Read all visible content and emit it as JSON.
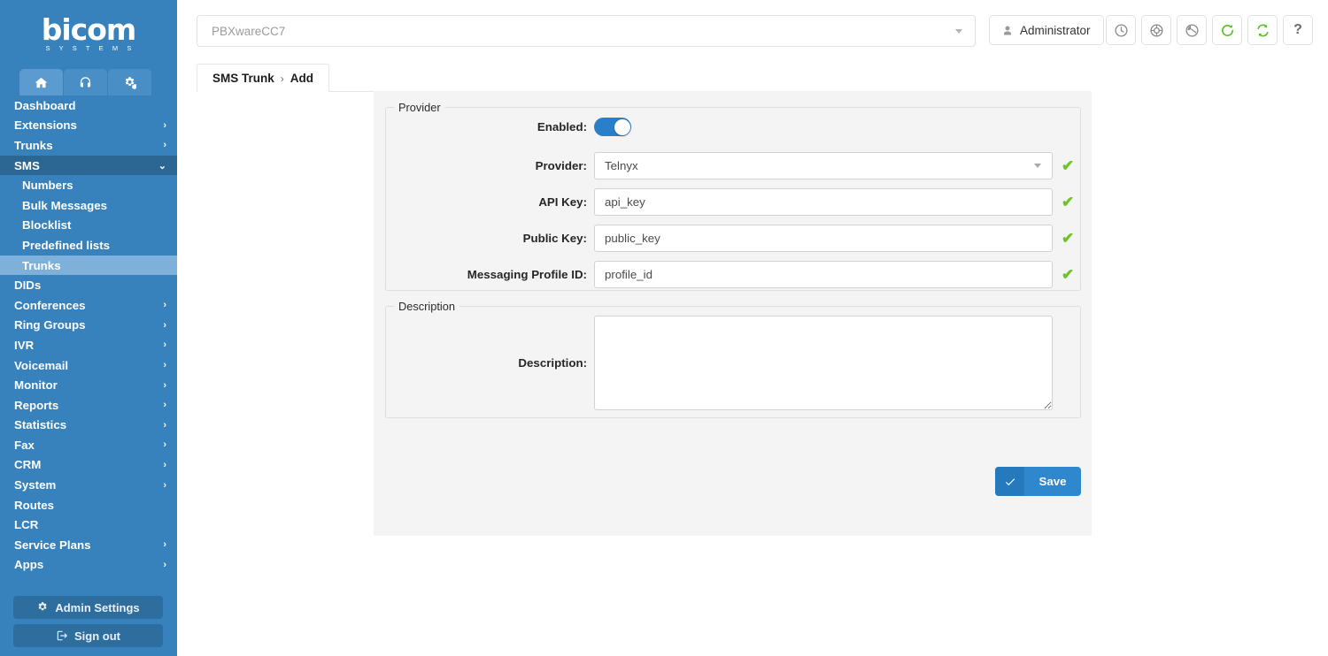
{
  "brand": {
    "word": "bicom",
    "sub": "S Y S T E M S"
  },
  "nav_tabs": [
    {
      "name": "home-tab",
      "icon": "home-icon",
      "active": true
    },
    {
      "name": "headset-tab",
      "icon": "headset-icon",
      "active": false
    },
    {
      "name": "gears-tab",
      "icon": "gears-icon",
      "active": false
    }
  ],
  "sidebar": {
    "items": [
      {
        "label": "Dashboard",
        "arrow": "",
        "state": ""
      },
      {
        "label": "Extensions",
        "arrow": "›",
        "state": ""
      },
      {
        "label": "Trunks",
        "arrow": "›",
        "state": ""
      },
      {
        "label": "SMS",
        "arrow": "⌄",
        "state": "open"
      }
    ],
    "submenu": [
      {
        "label": "Numbers",
        "state": ""
      },
      {
        "label": "Bulk Messages",
        "state": ""
      },
      {
        "label": "Blocklist",
        "state": ""
      },
      {
        "label": "Predefined lists",
        "state": ""
      },
      {
        "label": "Trunks",
        "state": "active"
      }
    ],
    "items_after": [
      {
        "label": "DIDs",
        "arrow": "",
        "state": ""
      },
      {
        "label": "Conferences",
        "arrow": "›",
        "state": ""
      },
      {
        "label": "Ring Groups",
        "arrow": "›",
        "state": ""
      },
      {
        "label": "IVR",
        "arrow": "›",
        "state": ""
      },
      {
        "label": "Voicemail",
        "arrow": "›",
        "state": ""
      },
      {
        "label": "Monitor",
        "arrow": "›",
        "state": ""
      },
      {
        "label": "Reports",
        "arrow": "›",
        "state": ""
      },
      {
        "label": "Statistics",
        "arrow": "›",
        "state": ""
      },
      {
        "label": "Fax",
        "arrow": "›",
        "state": ""
      },
      {
        "label": "CRM",
        "arrow": "›",
        "state": ""
      },
      {
        "label": "System",
        "arrow": "›",
        "state": ""
      },
      {
        "label": "Routes",
        "arrow": "",
        "state": ""
      },
      {
        "label": "LCR",
        "arrow": "",
        "state": ""
      },
      {
        "label": "Service Plans",
        "arrow": "›",
        "state": ""
      },
      {
        "label": "Apps",
        "arrow": "›",
        "state": ""
      }
    ],
    "admin_settings_label": "Admin Settings",
    "sign_out_label": "Sign out"
  },
  "topbar": {
    "server_value": "PBXwareCC7",
    "admin_label": "Administrator",
    "tools": [
      {
        "name": "clock-icon",
        "title": "clock"
      },
      {
        "name": "lifebuoy-icon",
        "title": "lifebuoy"
      },
      {
        "name": "globe-icon",
        "title": "globe"
      },
      {
        "name": "reload-icon",
        "title": "reload"
      },
      {
        "name": "sync-icon",
        "title": "sync"
      },
      {
        "name": "help-icon",
        "title": "?"
      }
    ],
    "help_glyph": "?"
  },
  "breadcrumb": {
    "root": "SMS Trunk",
    "separator": "›",
    "current": "Add"
  },
  "form": {
    "provider_legend": "Provider",
    "description_legend": "Description",
    "enabled_label": "Enabled:",
    "enabled_value": true,
    "provider_label": "Provider:",
    "provider_value": "Telnyx",
    "api_key_label": "API Key:",
    "api_key_value": "api_key",
    "public_key_label": "Public Key:",
    "public_key_value": "public_key",
    "messaging_profile_label": "Messaging Profile ID:",
    "messaging_profile_value": "profile_id",
    "description_label": "Description:",
    "description_value": "",
    "valid_mark": "✔",
    "save_label": "Save"
  },
  "colors": {
    "sidebar": "#3781bd",
    "sidebar_open": "#2c6693",
    "sidebar_active": "#7fb0da",
    "accent": "#2f87ce",
    "valid_green": "#6dc428",
    "panel": "#f4f4f4"
  }
}
